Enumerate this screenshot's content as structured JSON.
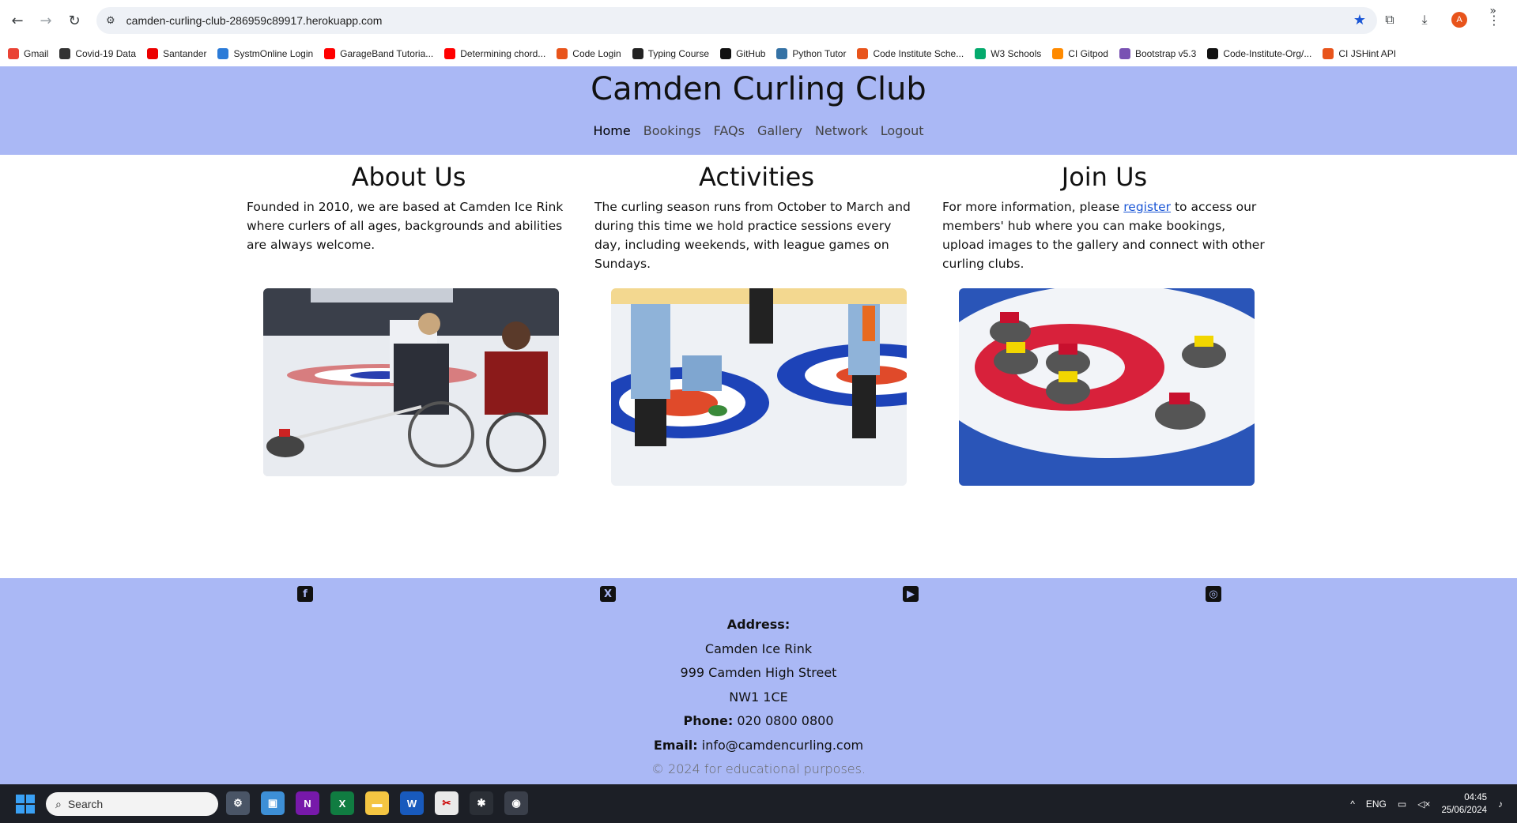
{
  "browser": {
    "url": "camden-curling-club-286959c89917.herokuapp.com",
    "avatar_letter": "A",
    "bookmarks": [
      {
        "label": "Gmail",
        "color": "#ea4335",
        "icon": "gmail-icon"
      },
      {
        "label": "Covid-19 Data",
        "color": "#333333",
        "icon": "data-icon"
      },
      {
        "label": "Santander",
        "color": "#ec0000",
        "icon": "santander-icon"
      },
      {
        "label": "SystmOnline Login",
        "color": "#2b7bd8",
        "icon": "systm-icon"
      },
      {
        "label": "GarageBand Tutoria...",
        "color": "#ff0000",
        "icon": "youtube-icon"
      },
      {
        "label": "Determining chord...",
        "color": "#ff0000",
        "icon": "youtube-icon"
      },
      {
        "label": "Code Login",
        "color": "#e8541b",
        "icon": "circle-icon"
      },
      {
        "label": "Typing Course",
        "color": "#222222",
        "icon": "p-icon"
      },
      {
        "label": "GitHub",
        "color": "#111111",
        "icon": "github-icon"
      },
      {
        "label": "Python Tutor",
        "color": "#3572a5",
        "icon": "python-icon"
      },
      {
        "label": "Code Institute Sche...",
        "color": "#e8541b",
        "icon": "circle-icon"
      },
      {
        "label": "W3 Schools",
        "color": "#04aa6d",
        "icon": "w3-icon"
      },
      {
        "label": "CI Gitpod",
        "color": "#ff8a00",
        "icon": "gitpod-icon"
      },
      {
        "label": "Bootstrap v5.3",
        "color": "#7952b3",
        "icon": "bootstrap-icon"
      },
      {
        "label": "Code-Institute-Org/...",
        "color": "#111111",
        "icon": "github-icon"
      },
      {
        "label": "CI JSHint API",
        "color": "#e8541b",
        "icon": "circle-icon"
      }
    ]
  },
  "site": {
    "title": "Camden Curling Club",
    "nav": [
      "Home",
      "Bookings",
      "FAQs",
      "Gallery",
      "Network",
      "Logout"
    ],
    "about": {
      "heading": "About Us",
      "text": "Founded in 2010, we are based at Camden Ice Rink where curlers of all ages, backgrounds and abilities are always welcome."
    },
    "activities": {
      "heading": "Activities",
      "text": "The curling season runs from October to March and during this time we hold practice sessions every day, including weekends, with league games on Sundays."
    },
    "join": {
      "heading": "Join Us",
      "text_before": "For more information, please ",
      "link": "register",
      "text_after": " to access our members' hub where you can make bookings, upload images to the gallery and connect with other curling clubs."
    },
    "footer": {
      "address_label": "Address:",
      "address_lines": [
        "Camden Ice Rink",
        "999 Camden High Street",
        "NW1 1CE"
      ],
      "phone_label": "Phone:",
      "phone": "020 0800 0800",
      "email_label": "Email:",
      "email": "info@camdencurling.com",
      "copyright": "© 2024 for educational purposes."
    }
  },
  "taskbar": {
    "search_placeholder": "Search",
    "lang": "ENG",
    "time": "04:45",
    "date": "25/06/2024"
  },
  "colors": {
    "header_bg": "#aab8f5",
    "link": "#1a56d6"
  }
}
